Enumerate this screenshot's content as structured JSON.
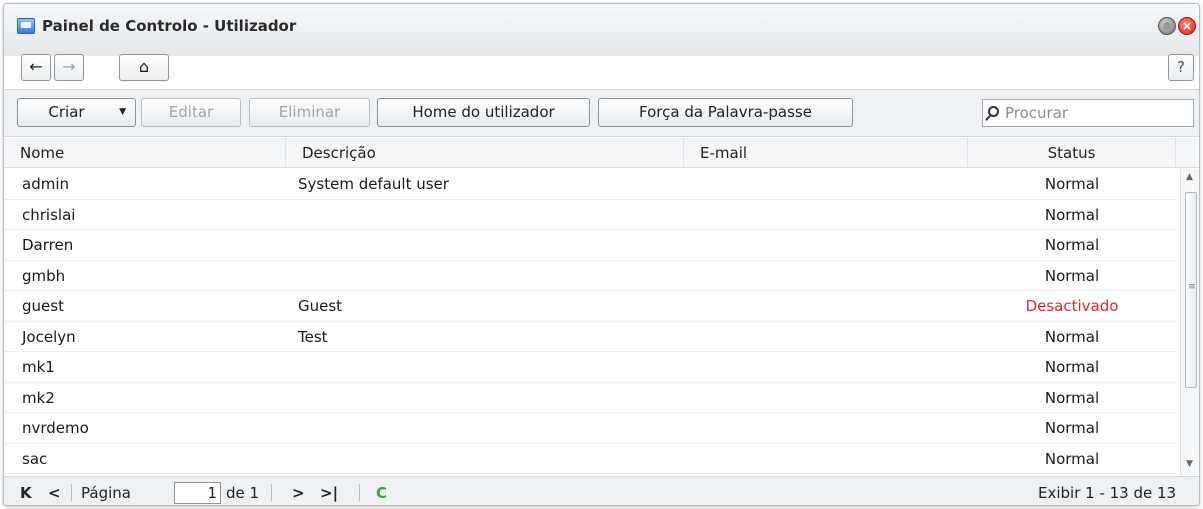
{
  "window": {
    "title": "Painel de Controlo - Utilizador"
  },
  "nav": {
    "back": "←",
    "forward": "→",
    "home": "⌂",
    "help": "?"
  },
  "toolbar": {
    "create_label": "Criar",
    "edit_label": "Editar",
    "delete_label": "Eliminar",
    "user_home_label": "Home do utilizador",
    "password_strength_label": "Força da Palavra-passe"
  },
  "search": {
    "placeholder": "Procurar"
  },
  "columns": [
    "Nome",
    "Descrição",
    "E-mail",
    "Status"
  ],
  "rows": [
    {
      "name": "admin",
      "description": "System default user",
      "email": "",
      "status": "Normal"
    },
    {
      "name": "chrislai",
      "description": "",
      "email": "",
      "status": "Normal"
    },
    {
      "name": "Darren",
      "description": "",
      "email": "",
      "status": "Normal"
    },
    {
      "name": "gmbh",
      "description": "",
      "email": "",
      "status": "Normal"
    },
    {
      "name": "guest",
      "description": "Guest",
      "email": "",
      "status": "Desactivado"
    },
    {
      "name": "Jocelyn",
      "description": "Test",
      "email": "",
      "status": "Normal"
    },
    {
      "name": "mk1",
      "description": "",
      "email": "",
      "status": "Normal"
    },
    {
      "name": "mk2",
      "description": "",
      "email": "",
      "status": "Normal"
    },
    {
      "name": "nvrdemo",
      "description": "",
      "email": "",
      "status": "Normal"
    },
    {
      "name": "sac",
      "description": "",
      "email": "",
      "status": "Normal"
    }
  ],
  "pagination": {
    "page_label": "Página",
    "current_page": "1",
    "of_label": "de 1",
    "display_text": "Exibir 1 - 13 de 13"
  },
  "colors": {
    "disabled_status": "#e02a22",
    "refresh": "#3aa53a"
  }
}
